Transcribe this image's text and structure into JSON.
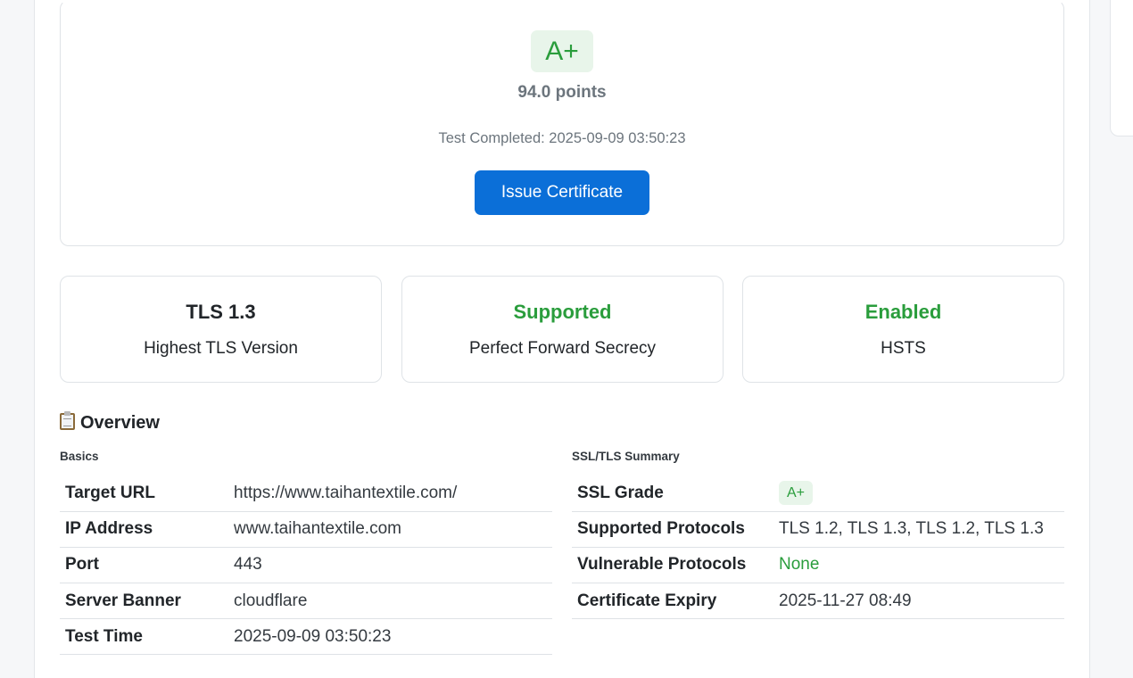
{
  "grade": {
    "badge": "A+",
    "points": "94.0 points",
    "test_completed": "Test Completed: 2025-09-09 03:50:23",
    "issue_button": "Issue Certificate"
  },
  "stats": [
    {
      "value": "TLS 1.3",
      "label": "Highest TLS Version",
      "value_color": "#212529"
    },
    {
      "value": "Supported",
      "label": "Perfect Forward Secrecy",
      "value_color": "#2a9d3c"
    },
    {
      "value": "Enabled",
      "label": "HSTS",
      "value_color": "#2a9d3c"
    }
  ],
  "overview": {
    "icon": "clipboard-icon",
    "title": "Overview",
    "basics": {
      "title": "Basics",
      "rows": [
        {
          "key": "Target URL",
          "value": "https://www.taihantextile.com/"
        },
        {
          "key": "IP Address",
          "value": "www.taihantextile.com"
        },
        {
          "key": "Port",
          "value": "443"
        },
        {
          "key": "Server Banner",
          "value": "cloudflare"
        },
        {
          "key": "Test Time",
          "value": "2025-09-09 03:50:23"
        }
      ]
    },
    "ssl_summary": {
      "title": "SSL/TLS Summary",
      "rows": [
        {
          "key": "SSL Grade",
          "value": "A+"
        },
        {
          "key": "Supported Protocols",
          "value": "TLS 1.2, TLS 1.3, TLS 1.2, TLS 1.3"
        },
        {
          "key": "Vulnerable Protocols",
          "value": "None"
        },
        {
          "key": "Certificate Expiry",
          "value": "2025-11-27 08:49"
        }
      ]
    }
  },
  "colors": {
    "accent": "#0b6fd8",
    "success": "#2a9d3c",
    "success_bg": "#e8f5ea",
    "muted": "#6c757d"
  }
}
